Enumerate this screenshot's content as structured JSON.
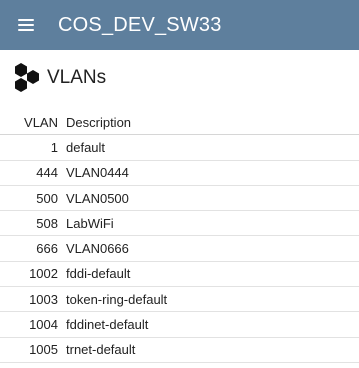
{
  "appbar": {
    "title": "COS_DEV_SW33",
    "menu_icon": "hamburger-menu-icon",
    "background": "#5e7f9d"
  },
  "section": {
    "title": "VLANs",
    "icon": "hexagon-cluster-icon"
  },
  "table": {
    "columns": [
      "VLAN",
      "Description"
    ],
    "rows": [
      {
        "vlan": "1",
        "description": "default"
      },
      {
        "vlan": "444",
        "description": "VLAN0444"
      },
      {
        "vlan": "500",
        "description": "VLAN0500"
      },
      {
        "vlan": "508",
        "description": "LabWiFi"
      },
      {
        "vlan": "666",
        "description": "VLAN0666"
      },
      {
        "vlan": "1002",
        "description": "fddi-default"
      },
      {
        "vlan": "1003",
        "description": "token-ring-default"
      },
      {
        "vlan": "1004",
        "description": "fddinet-default"
      },
      {
        "vlan": "1005",
        "description": "trnet-default"
      }
    ]
  }
}
